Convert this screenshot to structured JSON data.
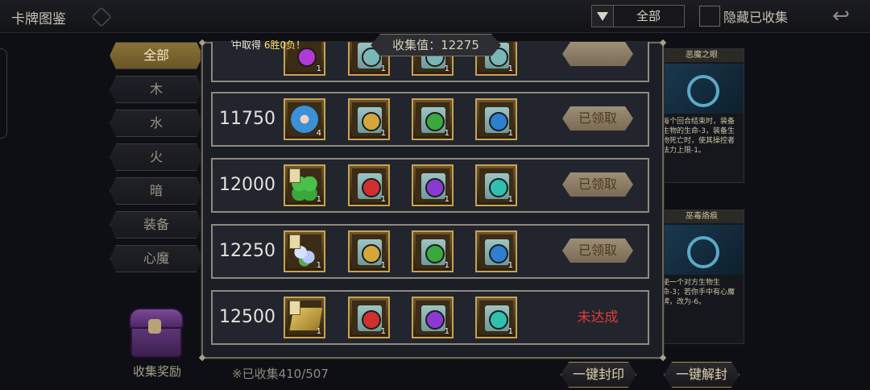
{
  "header": {
    "title": "卡牌图鉴",
    "filter_value": "全部",
    "hide_collected_label": "隐藏已收集"
  },
  "sidebar": {
    "categories": [
      {
        "label": "全部",
        "active": true
      },
      {
        "label": "木",
        "active": false
      },
      {
        "label": "水",
        "active": false
      },
      {
        "label": "火",
        "active": false
      },
      {
        "label": "暗",
        "active": false
      },
      {
        "label": "装备",
        "active": false
      },
      {
        "label": "心魔",
        "active": false
      }
    ],
    "collect_reward_label": "收集奖励"
  },
  "footer": {
    "collected_text": "※已收集410/507",
    "seal_all_label": "一键封印",
    "unseal_all_label": "一键解封"
  },
  "right_cards": [
    {
      "name": "恶魔之眼",
      "desc": "每个回合结束时，装备生物的生命-3，装备生物死亡时，使其操控者法力上限-1。"
    },
    {
      "name": "巫毒烙痕",
      "desc": "使一个对方生物生命-3；若你手中有心魔牌，改为-6。"
    }
  ],
  "modal": {
    "title": "收集值：12275",
    "notice_prefix": "中取得",
    "notice_highlight": "6胜0负",
    "notice_suffix": "！",
    "rows": [
      {
        "value": "",
        "status": "claimed",
        "status_label": "",
        "items": [
          {
            "kind": "gem",
            "color": "#b03ad8",
            "qty": "1"
          },
          {
            "kind": "scroll",
            "color": "#7ab6b6",
            "qty": "1"
          },
          {
            "kind": "scroll",
            "color": "#7ab6b6",
            "qty": "1"
          },
          {
            "kind": "scroll",
            "color": "#7ab6b6",
            "qty": "1"
          }
        ]
      },
      {
        "value": "11750",
        "status": "claimed",
        "status_label": "已领取",
        "items": [
          {
            "kind": "flame",
            "color": "#3b90d8",
            "qty": "4"
          },
          {
            "kind": "scroll",
            "color": "#d4a63c",
            "qty": "1"
          },
          {
            "kind": "scroll",
            "color": "#3aa83c",
            "qty": "1"
          },
          {
            "kind": "scroll",
            "color": "#2d7fcf",
            "qty": "1"
          }
        ]
      },
      {
        "value": "12000",
        "status": "claimed",
        "status_label": "已领取",
        "items": [
          {
            "kind": "clover",
            "color": "#49c04a",
            "qty": "1"
          },
          {
            "kind": "scroll",
            "color": "#d03030",
            "qty": "1"
          },
          {
            "kind": "scroll",
            "color": "#8a3ad0",
            "qty": "1"
          },
          {
            "kind": "scroll",
            "color": "#2fc0b0",
            "qty": "1"
          }
        ]
      },
      {
        "value": "12250",
        "status": "claimed",
        "status_label": "已领取",
        "items": [
          {
            "kind": "flower",
            "color": "#b7c8ff",
            "qty": "1"
          },
          {
            "kind": "scroll",
            "color": "#d4a63c",
            "qty": "1"
          },
          {
            "kind": "scroll",
            "color": "#3aa83c",
            "qty": "1"
          },
          {
            "kind": "scroll",
            "color": "#2d7fcf",
            "qty": "1"
          }
        ]
      },
      {
        "value": "12500",
        "status": "unreached",
        "status_label": "未达成",
        "items": [
          {
            "kind": "tome",
            "color": "#e3c463",
            "qty": "1"
          },
          {
            "kind": "scroll",
            "color": "#d03030",
            "qty": "1"
          },
          {
            "kind": "scroll",
            "color": "#8a3ad0",
            "qty": "1"
          },
          {
            "kind": "scroll",
            "color": "#2fc0b0",
            "qty": "1"
          }
        ]
      }
    ]
  }
}
